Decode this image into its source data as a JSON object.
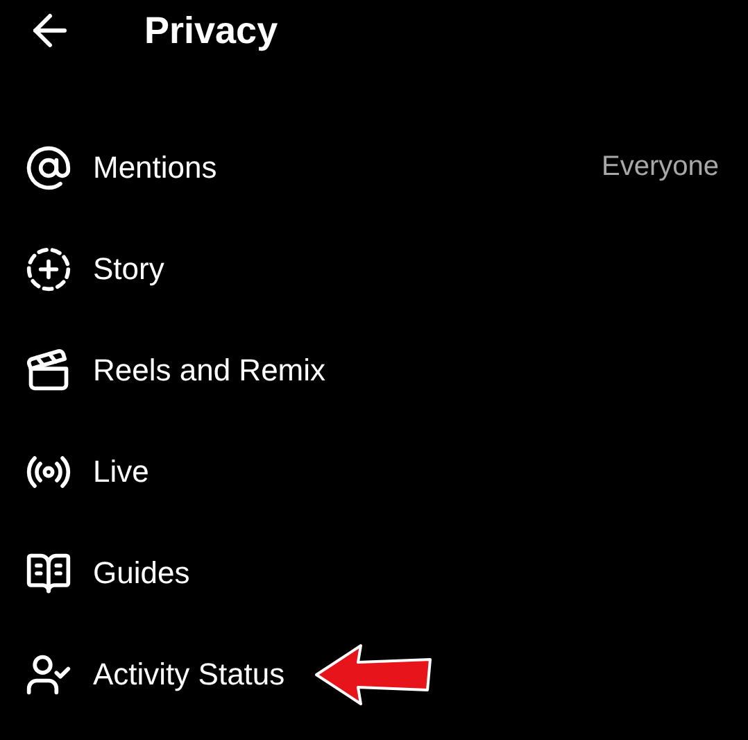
{
  "header": {
    "title": "Privacy"
  },
  "items": [
    {
      "label": "Mentions",
      "value": "Everyone"
    },
    {
      "label": "Story"
    },
    {
      "label": "Reels and Remix"
    },
    {
      "label": "Live"
    },
    {
      "label": "Guides"
    },
    {
      "label": "Activity Status"
    }
  ]
}
